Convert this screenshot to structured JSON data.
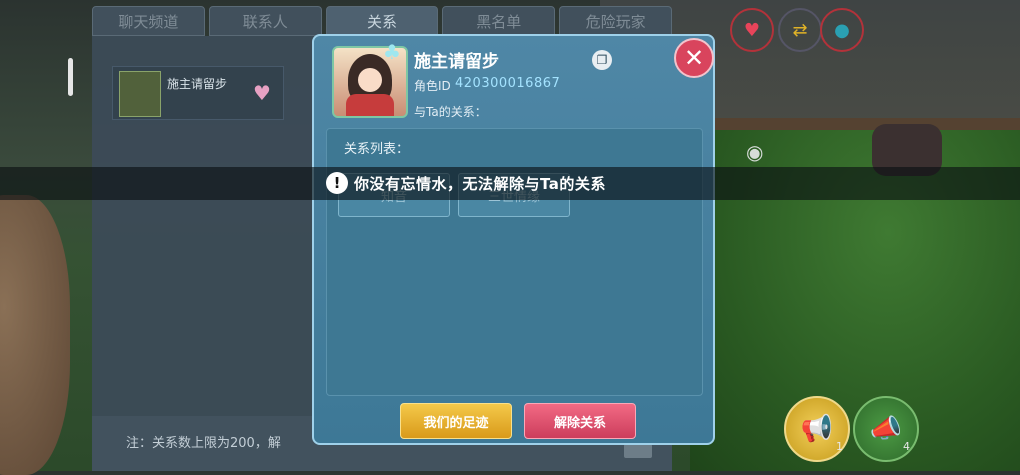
{
  "tabs": [
    "聊天频道",
    "联系人",
    "关系",
    "黑名单",
    "危险玩家"
  ],
  "friend_list": [
    {
      "name": "施主请留步"
    }
  ],
  "note": "注：关系数上限为200，解",
  "dialog": {
    "name": "施主请留步",
    "id_label": "角色ID",
    "id_value": "420300016867",
    "relationship_label": "与Ta的关系：",
    "list_label": "关系列表：",
    "relationships": [
      "知音",
      "三世情缘"
    ],
    "btn_footprints": "我们的足迹",
    "btn_remove": "解除关系"
  },
  "toast": {
    "text": "你没有忘情水，无法解除与Ta的关系",
    "icon": "exclamation-icon"
  },
  "hud_icons": [
    "heart-icon",
    "swap-icon",
    "water-drop-icon"
  ],
  "action_buttons": [
    {
      "icon": "megaphone-icon",
      "count": "1"
    },
    {
      "icon": "megaphone-icon",
      "count": "4"
    }
  ]
}
